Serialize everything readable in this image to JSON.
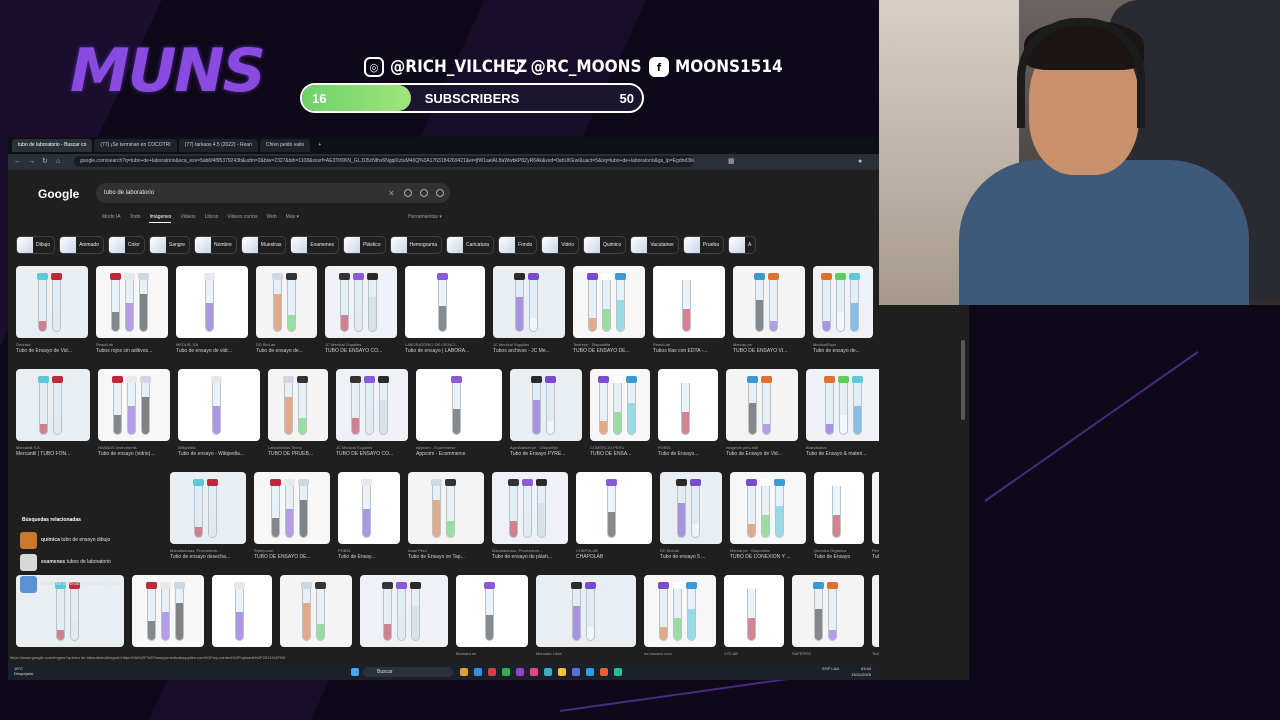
{
  "overlay": {
    "logo": "MUNS",
    "instagram_icon": "instagram-icon",
    "instagram": "@RICH_VILCHEZ",
    "tiktok_icon": "tiktok-icon",
    "tiktok": "@RC_MOONS",
    "facebook_icon": "facebook-icon",
    "facebook": "MOONS1514",
    "subs_current": "16",
    "subs_label": "SUBSCRIBERS",
    "subs_goal": "50",
    "subs_progress": 0.32,
    "accent": "#8a4ce0",
    "progress_color": "#7ed96f"
  },
  "browser": {
    "tabs": [
      {
        "label": "tubo de laboratorio - Buscar co",
        "active": true
      },
      {
        "label": "(77) ¡Se terminan en COCOTRI"
      },
      {
        "label": "(77) tarkaos 4.5 (2022) - Rean"
      },
      {
        "label": "Chivo peido vaite"
      }
    ],
    "new_tab": "+",
    "url": "google.com/search?q=tubo+de+laboratorio&sca_esv=5ab6f4f95379243b&udm=2&biw=2327&bih=1108&sxsrf=AE3TifXKN_GLJ1l5cNthv6NgqlXztuM46Q%3A1763184269421&ei=jfW1aeiAL8aWwbkP8ZyR6Ak&ved=0ahUKEwi&uact=5&oq=tubo+de+laboratorio&gs_lp=Egdnd3Mtd2l6"
  },
  "google": {
    "logo": "Google",
    "query": "tubo de laboratorio",
    "tabs": [
      "Modo IA",
      "Todo",
      "Imágenes",
      "Videos",
      "Libros",
      "Videos cortos",
      "Web",
      "Más ▾"
    ],
    "active_tab": "Imágenes",
    "tools": "Herramientas ▾",
    "chips": [
      "Dibujo",
      "Animado",
      "Color",
      "Sangre",
      "Nombre",
      "Muestras",
      "Examenes",
      "Plástico",
      "Hemograma",
      "Caricatura",
      "Fondo",
      "Vidrio",
      "Quimico",
      "Vacutainer",
      "Prueba",
      "A"
    ],
    "row1": [
      {
        "src": "Oechsle",
        "title": "Tubo de Ensayo de Vid..."
      },
      {
        "src": "ReactLab",
        "title": "Tubos rojos sin aditivos..."
      },
      {
        "src": "MEDUR_SA",
        "title": "Tubo de ensayo de vidr..."
      },
      {
        "src": "DD BioLab",
        "title": "Tubo de ensayo de..."
      },
      {
        "src": "JC Medical Supplies",
        "title": "TUBO DE ENSAYO CO..."
      },
      {
        "src": "LABORATORIO DE CIENCI...",
        "title": "Tubo de ensayo | LABORA..."
      },
      {
        "src": "JC Medical Supplies",
        "title": "Tubos archivos - JC Me..."
      },
      {
        "src": "Tecfresh · Disponible",
        "title": "TUBO DE ENSAYO DE..."
      },
      {
        "src": "ReactLab",
        "title": "Tubos lilas con EDTA -..."
      },
      {
        "src": "Mercau.pe",
        "title": "TUBO DE ENSAYO VI..."
      },
      {
        "src": "MedicalExpo",
        "title": "Tubo de ensayo de..."
      },
      {
        "src": "Jr medic",
        "title": "Tubo DE ENSAYO 12 X..."
      }
    ],
    "row2": [
      {
        "src": "Mercantil S.A.",
        "title": "Mercantil | TUBO FON..."
      },
      {
        "src": "HANNAS Instruments",
        "title": "Tubo de ensayo (vidrio)..."
      },
      {
        "src": "Wikipedia",
        "title": "Tubo de ensayo - Wikipedia..."
      },
      {
        "src": "Laboratorios Tecno",
        "title": "TUBO DE PRUEB..."
      },
      {
        "src": "JC Medical Supplies",
        "title": "TUBO DE ENSAYO CO..."
      },
      {
        "src": "Appcom - Ecommerce",
        "title": "Appcom - Ecommerce"
      },
      {
        "src": "AgroMarket.pe · Disponible",
        "title": "Tubo de Ensayo PYRE..."
      },
      {
        "src": "COMERCIO PERU",
        "title": "TUBO DE ENSA..."
      },
      {
        "src": "POBEL",
        "title": "Tubo de Ensayo..."
      },
      {
        "src": "reagente.peru.ekit",
        "title": "Tubo de Ensayo de Vid..."
      },
      {
        "src": "Brandtubos",
        "title": "Tubo de Ensayo & materi..."
      },
      {
        "src": "MedicalExpo",
        "title": "Tubo de ensayo..."
      }
    ],
    "related": {
      "heading": "Búsquedas relacionadas",
      "items": [
        {
          "bold": "química",
          "rest": " tubo de ensayo dibujo"
        },
        {
          "bold": "examenes",
          "rest": " tubos de laboratorio"
        },
        {
          "bold": "tubos",
          "rest": " de laboratorio colores y usos"
        }
      ]
    },
    "row3": [
      {
        "src": "Manufacturas, Proveedore...",
        "title": "Tubo de ensayo desecha..."
      },
      {
        "src": "Ripley.com",
        "title": "TUBO DE ENSAYO DE..."
      },
      {
        "src": "POBEL",
        "title": "Tubo de Ensay..."
      },
      {
        "src": "Arasi Peru",
        "title": "Tubo de Ensayo on Tap..."
      },
      {
        "src": "Manufacturas, Proveedore...",
        "title": "Tubo de ensayo de plásti..."
      },
      {
        "src": "CHAPOLAB",
        "title": "CHAPOLAB"
      },
      {
        "src": "DD BioLab",
        "title": "Tubo de ensayo 5 ..."
      },
      {
        "src": "Mercar.pe · Disponible",
        "title": "TUBO DE CONEXIÓN Y ..."
      },
      {
        "src": "Química Organica",
        "title": "Tubo de Ensayo"
      },
      {
        "src": "Pinterest",
        "title": "Tubo De Ensayo Químic..."
      }
    ],
    "row4": [
      {
        "src": "",
        "title": ""
      },
      {
        "src": "",
        "title": ""
      },
      {
        "src": "",
        "title": ""
      },
      {
        "src": "",
        "title": ""
      },
      {
        "src": "",
        "title": ""
      },
      {
        "src": "Biomam.pe",
        "title": ""
      },
      {
        "src": "Mercado Libre",
        "title": ""
      },
      {
        "src": "es.hawach.com",
        "title": ""
      },
      {
        "src": "VITLAB",
        "title": ""
      },
      {
        "src": "SAFEPRO",
        "title": ""
      },
      {
        "src": "Tecfresh · Disponible",
        "title": ""
      }
    ],
    "status_url": "https://www.google.com/imgres?q=tubo de laboratorio&imgurl=https%3A%2F%2Fwww.jcmedicalsupplies.com%2Fwp-content%2Fuploads%2F2021%2F09/"
  },
  "taskbar": {
    "weather_temp": "16°C",
    "weather_desc": "Despejado",
    "search": "Buscar",
    "lang": "ESP LAA",
    "time": "03:44",
    "date": "15/11/2025"
  }
}
